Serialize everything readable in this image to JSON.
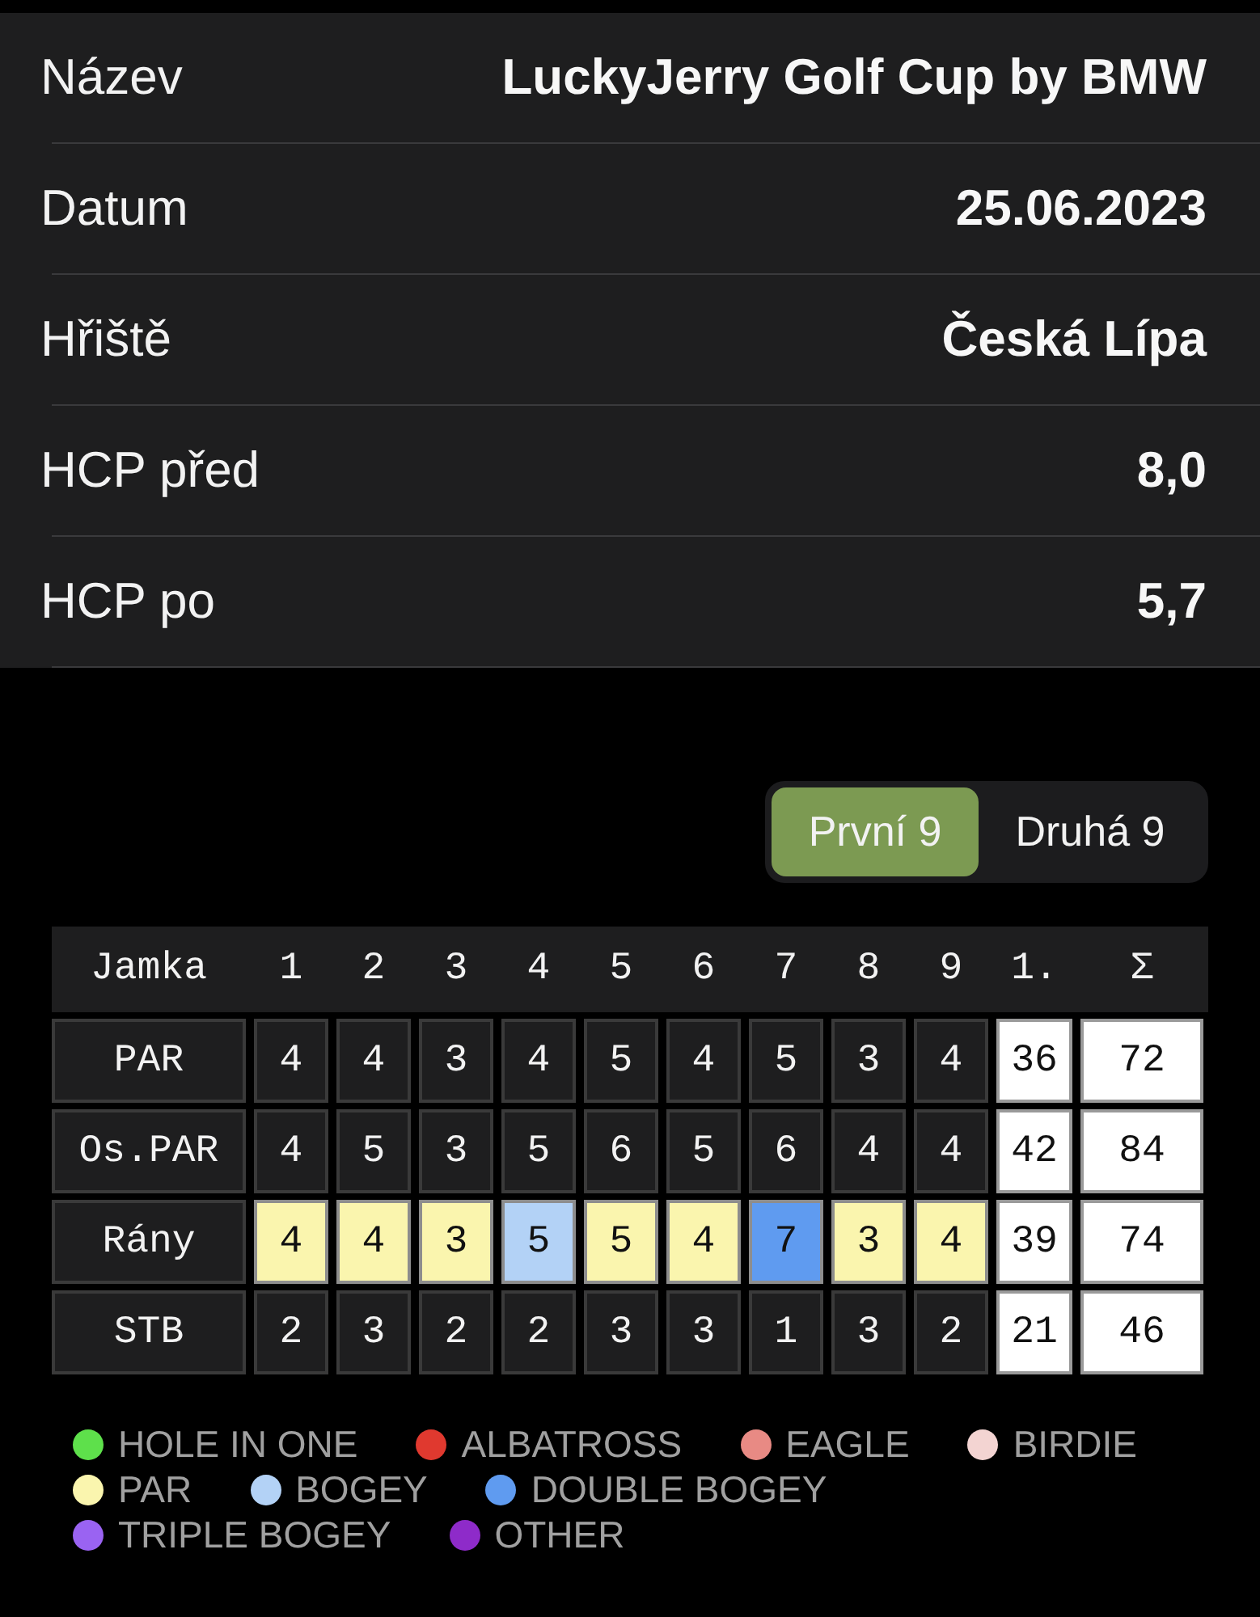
{
  "details": [
    {
      "label": "Název",
      "value": "LuckyJerry Golf Cup by BMW"
    },
    {
      "label": "Datum",
      "value": "25.06.2023"
    },
    {
      "label": "Hřiště",
      "value": "Česká Lípa"
    },
    {
      "label": "HCP před",
      "value": "8,0"
    },
    {
      "label": "HCP po",
      "value": "5,7"
    }
  ],
  "segments": [
    {
      "label": "První 9",
      "selected": true
    },
    {
      "label": "Druhá 9",
      "selected": false
    }
  ],
  "scorecard": {
    "columns": [
      "Jamka",
      "1",
      "2",
      "3",
      "4",
      "5",
      "6",
      "7",
      "8",
      "9",
      "1.",
      "Σ"
    ],
    "rows": [
      {
        "cells": [
          {
            "kind": "label",
            "value": "PAR"
          },
          {
            "kind": "score",
            "value": "4"
          },
          {
            "kind": "score",
            "value": "4"
          },
          {
            "kind": "score",
            "value": "3"
          },
          {
            "kind": "score",
            "value": "4"
          },
          {
            "kind": "score",
            "value": "5"
          },
          {
            "kind": "score",
            "value": "4"
          },
          {
            "kind": "score",
            "value": "5"
          },
          {
            "kind": "score",
            "value": "3"
          },
          {
            "kind": "score",
            "value": "4"
          },
          {
            "kind": "total",
            "value": "36"
          },
          {
            "kind": "total",
            "value": "72"
          }
        ]
      },
      {
        "cells": [
          {
            "kind": "label",
            "value": "Os.PAR"
          },
          {
            "kind": "score",
            "value": "4"
          },
          {
            "kind": "score",
            "value": "5"
          },
          {
            "kind": "score",
            "value": "3"
          },
          {
            "kind": "score",
            "value": "5"
          },
          {
            "kind": "score",
            "value": "6"
          },
          {
            "kind": "score",
            "value": "5"
          },
          {
            "kind": "score",
            "value": "6"
          },
          {
            "kind": "score",
            "value": "4"
          },
          {
            "kind": "score",
            "value": "4"
          },
          {
            "kind": "total",
            "value": "42"
          },
          {
            "kind": "total",
            "value": "84"
          }
        ]
      },
      {
        "cells": [
          {
            "kind": "label",
            "value": "Rány"
          },
          {
            "kind": "score",
            "value": "4",
            "color": "#faf5ae"
          },
          {
            "kind": "score",
            "value": "4",
            "color": "#faf5ae"
          },
          {
            "kind": "score",
            "value": "3",
            "color": "#faf5ae"
          },
          {
            "kind": "score",
            "value": "5",
            "color": "#b3d2f6"
          },
          {
            "kind": "score",
            "value": "5",
            "color": "#faf5ae"
          },
          {
            "kind": "score",
            "value": "4",
            "color": "#faf5ae"
          },
          {
            "kind": "score",
            "value": "7",
            "color": "#5f9bf0"
          },
          {
            "kind": "score",
            "value": "3",
            "color": "#faf5ae"
          },
          {
            "kind": "score",
            "value": "4",
            "color": "#faf5ae"
          },
          {
            "kind": "total",
            "value": "39"
          },
          {
            "kind": "total",
            "value": "74"
          }
        ]
      },
      {
        "cells": [
          {
            "kind": "label",
            "value": "STB"
          },
          {
            "kind": "score",
            "value": "2"
          },
          {
            "kind": "score",
            "value": "3"
          },
          {
            "kind": "score",
            "value": "2"
          },
          {
            "kind": "score",
            "value": "2"
          },
          {
            "kind": "score",
            "value": "3"
          },
          {
            "kind": "score",
            "value": "3"
          },
          {
            "kind": "score",
            "value": "1"
          },
          {
            "kind": "score",
            "value": "3"
          },
          {
            "kind": "score",
            "value": "2"
          },
          {
            "kind": "total",
            "value": "21"
          },
          {
            "kind": "total",
            "value": "46"
          }
        ]
      }
    ]
  },
  "legend_rows": [
    {
      "items": [
        {
          "label": "HOLE IN ONE",
          "color": "#5ee04b"
        },
        {
          "label": "ALBATROSS",
          "color": "#e0392f"
        },
        {
          "label": "EAGLE",
          "color": "#e88a84"
        },
        {
          "label": "BIRDIE",
          "color": "#f3d4d2"
        }
      ]
    },
    {
      "items": [
        {
          "label": "PAR",
          "color": "#faf5ae"
        },
        {
          "label": "BOGEY",
          "color": "#b3d2f6"
        },
        {
          "label": "DOUBLE BOGEY",
          "color": "#5f9bf0"
        }
      ]
    },
    {
      "items": [
        {
          "label": "TRIPLE BOGEY",
          "color": "#9a63f2"
        },
        {
          "label": "OTHER",
          "color": "#8e2bc9"
        }
      ]
    }
  ]
}
